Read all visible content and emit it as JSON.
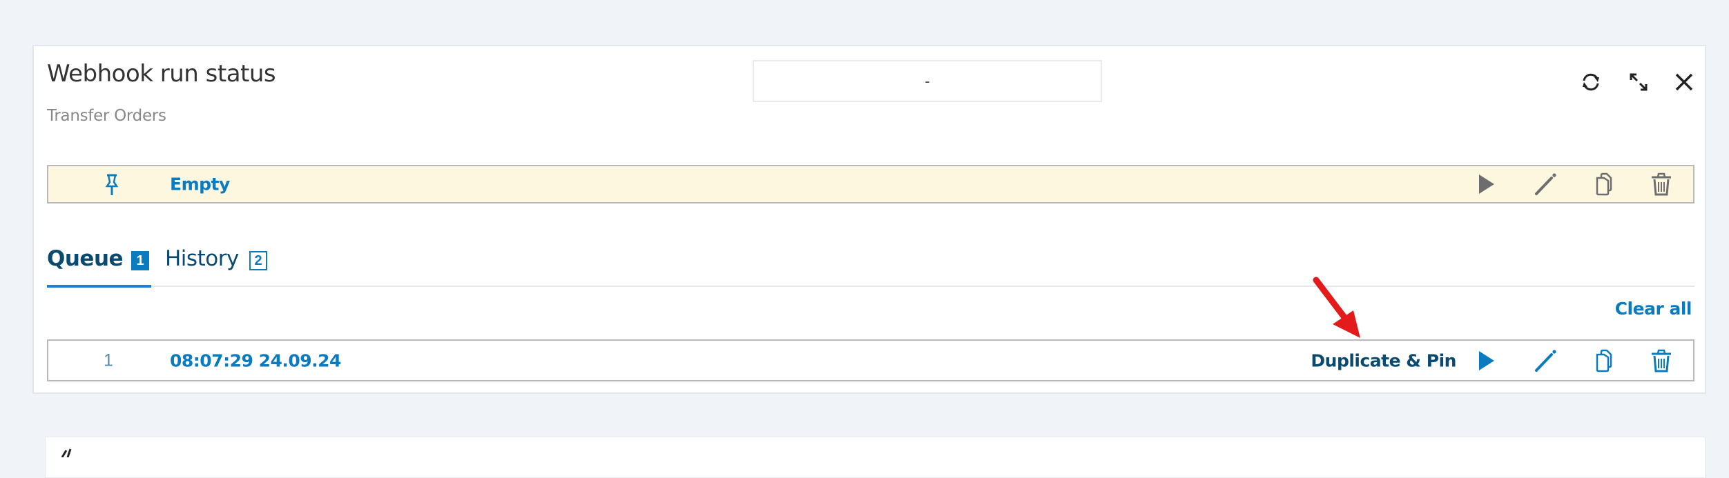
{
  "widget": {
    "title": "Webhook run status",
    "subtitle": "Transfer Orders",
    "selector_value": "-",
    "header_icons": [
      "refresh-icon",
      "expand-icon",
      "close-icon"
    ]
  },
  "pinned": {
    "icon": "pin-icon",
    "label": "Empty",
    "actions": [
      "play-icon",
      "pencil-icon",
      "copy-icon",
      "trash-icon"
    ],
    "state": "disabled"
  },
  "tabs": [
    {
      "label": "Queue",
      "count": "1",
      "active": true
    },
    {
      "label": "History",
      "count": "2",
      "active": false
    }
  ],
  "queue": {
    "clear_all_label": "Clear all",
    "rows": [
      {
        "index": "1",
        "timestamp": "08:07:29 24.09.24",
        "hover_label": "Duplicate & Pin",
        "actions": [
          "play-icon",
          "pencil-icon",
          "copy-icon",
          "trash-icon"
        ]
      }
    ]
  },
  "colors": {
    "accent": "#0a7bbf",
    "tab_text": "#0b4a6e",
    "pinned_bg": "#fdf7e0",
    "annotation_arrow": "#e31b1b",
    "page_bg": "#f0f3f8"
  }
}
